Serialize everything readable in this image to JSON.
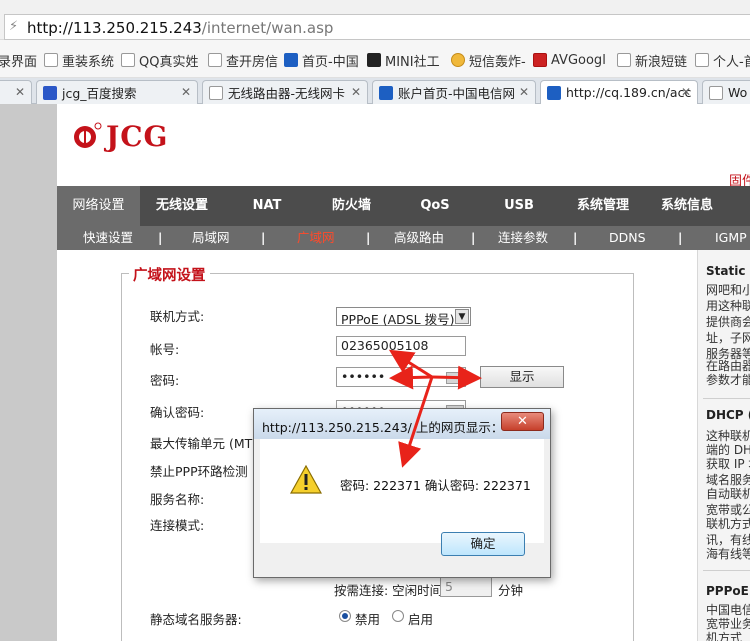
{
  "browser": {
    "address_host": "http://113.250.215.243",
    "address_path": "/internet/wan.asp",
    "bookmarks": [
      "录界面",
      "重装系统",
      "QQ真实姓",
      "查开房信",
      "首页-中国",
      "MINI社工",
      "短信轰炸-",
      "AVGoogl",
      "新浪短链",
      "个人-首"
    ],
    "tabs": [
      "",
      "jcg_百度搜索",
      "无线路由器-无线网卡",
      "账户首页-中国电信网",
      "http://cq.189.cn/acc",
      "Wo"
    ]
  },
  "header": {
    "logo_text": "JCG",
    "top_right_link": "固件"
  },
  "main_nav": [
    "网络设置",
    "无线设置",
    "NAT",
    "防火墙",
    "QoS",
    "USB",
    "系统管理",
    "系统信息"
  ],
  "sub_nav": [
    "快速设置",
    "局域网",
    "广域网",
    "高级路由",
    "连接参数",
    "DDNS",
    "IGMP"
  ],
  "form": {
    "legend": "广域网设置",
    "labels": {
      "connection_type": "联机方式:",
      "account": "帐号:",
      "password": "密码:",
      "confirm_password": "确认密码:",
      "mtu": "最大传输单元 (MTU",
      "disable_ppp_loop": "禁止PPP环路检测",
      "service_name": "服务名称:",
      "connect_mode": "连接模式:",
      "static_dns": "静态域名服务器:"
    },
    "connection_type_value": "PPPoE (ADSL 拨号)",
    "account_value": "02365005108",
    "password_mask": "••••••",
    "confirm_mask": "••••••",
    "show_button": "显示",
    "on_demand_label": "按需连接: 空闲时间",
    "idle_value": "5",
    "idle_unit": "分钟",
    "dns_options": [
      "禁用",
      "启用"
    ]
  },
  "right_panel": {
    "sections": [
      {
        "title": "Static (",
        "lines": [
          "网吧和小",
          "用这种联",
          "提供商会",
          "址，子网",
          "服务器等",
          "在路由器",
          "参数才能"
        ]
      },
      {
        "title": "DHCP (",
        "lines": [
          "这种联机",
          "端的 DH",
          "获取 IP 地",
          "域名服务",
          "自动联机",
          "宽带或公",
          "联机方式",
          "讯，有线",
          "海有线等"
        ]
      },
      {
        "title": "PPPoE (",
        "lines": [
          "中国电信",
          "宽带业务",
          "机方式"
        ]
      }
    ]
  },
  "dialog": {
    "title": "http://113.250.215.243/ 上的网页显示：",
    "message": "密码: 222371 确认密码: 222371",
    "ok_label": "确定",
    "close_symbol": "✕"
  },
  "colors": {
    "brand_red": "#c4121a",
    "nav_bg": "#4c4c4c",
    "subnav_bg": "#6b6b6b",
    "active_sub": "#ff4a2a",
    "arrow_red": "#e8231a"
  }
}
